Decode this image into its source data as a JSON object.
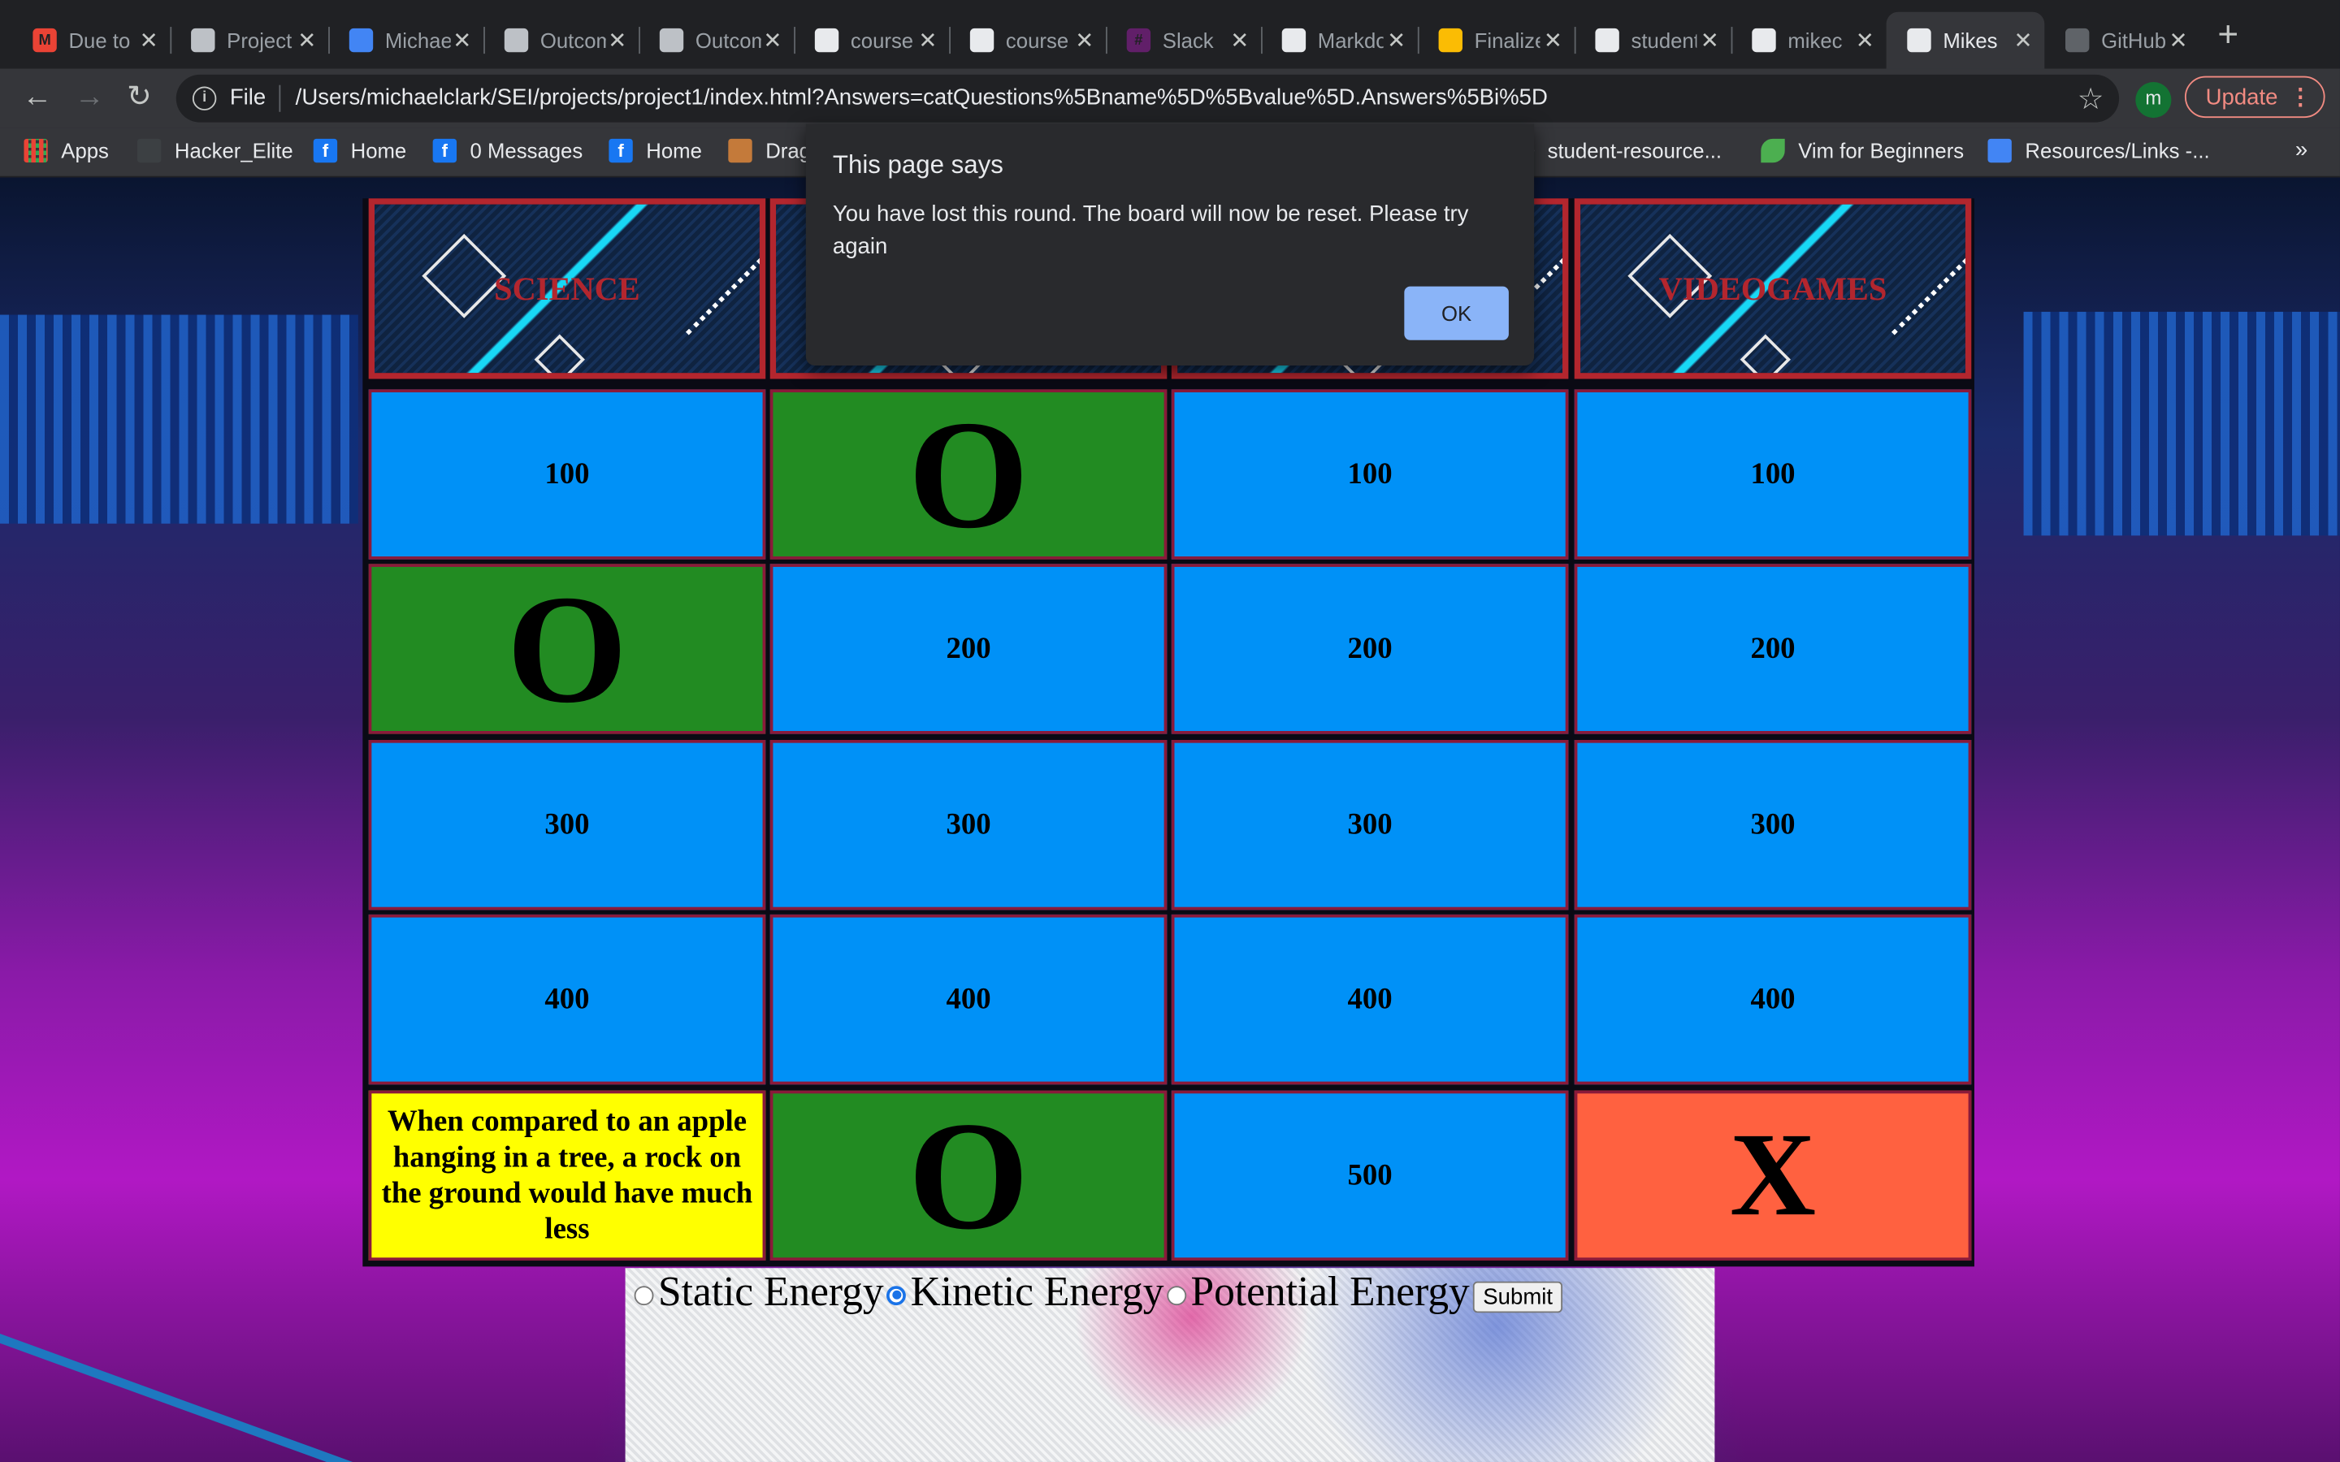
{
  "browser": {
    "tabs": [
      {
        "title": "Due to",
        "icon": "gmail-icon",
        "ico_text": "M",
        "ico_color": "#ea4335"
      },
      {
        "title": "Project",
        "icon": "classroom-icon",
        "ico_text": "",
        "ico_color": "#bdc1c6"
      },
      {
        "title": "Michael",
        "icon": "google-docs-icon",
        "ico_text": "",
        "ico_color": "#4285f4"
      },
      {
        "title": "Outcomes",
        "icon": "classroom-icon",
        "ico_text": "",
        "ico_color": "#bdc1c6"
      },
      {
        "title": "Outcomes",
        "icon": "classroom-icon",
        "ico_text": "",
        "ico_color": "#bdc1c6"
      },
      {
        "title": "course",
        "icon": "github-icon",
        "ico_text": "",
        "ico_color": "#e8eaed"
      },
      {
        "title": "course",
        "icon": "github-icon",
        "ico_text": "",
        "ico_color": "#e8eaed"
      },
      {
        "title": "Slack",
        "icon": "slack-icon",
        "ico_text": "#",
        "ico_color": "#611f69"
      },
      {
        "title": "Markdown",
        "icon": "github-icon",
        "ico_text": "",
        "ico_color": "#e8eaed"
      },
      {
        "title": "Finalize",
        "icon": "slides-icon",
        "ico_text": "",
        "ico_color": "#fbbc04"
      },
      {
        "title": "student",
        "icon": "github-icon",
        "ico_text": "",
        "ico_color": "#e8eaed"
      },
      {
        "title": "mikec",
        "icon": "github-icon",
        "ico_text": "",
        "ico_color": "#e8eaed"
      },
      {
        "title": "Mikes",
        "icon": "globe-icon",
        "ico_text": "",
        "ico_color": "#e8eaed",
        "active": true
      },
      {
        "title": "GitHub",
        "icon": "github-icon",
        "ico_text": "",
        "ico_color": "#5f6368"
      }
    ],
    "new_tab_label": "+",
    "url_scheme": "File",
    "url": "/Users/michaelclark/SEI/projects/project1/index.html?Answers=catQuestions%5Bname%5D%5Bvalue%5D.Answers%5Bi%5D",
    "profile_initial": "m",
    "update_label": "Update",
    "bookmarks": [
      {
        "label": "Apps",
        "icon": "apps-grid-icon"
      },
      {
        "label": "Hacker_Elite",
        "icon": "bookmark-icon"
      },
      {
        "label": "Home",
        "icon": "facebook-icon"
      },
      {
        "label": "0 Messages",
        "icon": "facebook-icon"
      },
      {
        "label": "Home",
        "icon": "facebook-icon"
      },
      {
        "label": "Drag",
        "icon": "image-icon"
      },
      {
        "label": "student-resource...",
        "icon": "github-icon"
      },
      {
        "label": "Vim for Beginners",
        "icon": "vim-leaf-icon"
      },
      {
        "label": "Resources/Links -...",
        "icon": "google-docs-icon"
      }
    ],
    "bookmarks_more": "»"
  },
  "dialog": {
    "title": "This page says",
    "message": "You have lost this round. The board will now be reset. Please try again",
    "ok_label": "OK"
  },
  "board": {
    "categories": [
      "SCIENCE",
      "",
      "",
      "VIDEOGAMES"
    ],
    "rows": [
      [
        {
          "text": "100",
          "state": "blue"
        },
        {
          "text": "O",
          "state": "green"
        },
        {
          "text": "100",
          "state": "blue"
        },
        {
          "text": "100",
          "state": "blue"
        }
      ],
      [
        {
          "text": "O",
          "state": "green"
        },
        {
          "text": "200",
          "state": "blue"
        },
        {
          "text": "200",
          "state": "blue"
        },
        {
          "text": "200",
          "state": "blue"
        }
      ],
      [
        {
          "text": "300",
          "state": "blue"
        },
        {
          "text": "300",
          "state": "blue"
        },
        {
          "text": "300",
          "state": "blue"
        },
        {
          "text": "300",
          "state": "blue"
        }
      ],
      [
        {
          "text": "400",
          "state": "blue"
        },
        {
          "text": "400",
          "state": "blue"
        },
        {
          "text": "400",
          "state": "blue"
        },
        {
          "text": "400",
          "state": "blue"
        }
      ],
      [
        {
          "text": "When compared to an apple hanging in a tree, a rock on the ground would have much less",
          "state": "yellow"
        },
        {
          "text": "O",
          "state": "green"
        },
        {
          "text": "500",
          "state": "blue"
        },
        {
          "text": "X",
          "state": "orange"
        }
      ]
    ]
  },
  "answers": {
    "options": [
      {
        "label": "Static Energy",
        "checked": false
      },
      {
        "label": "Kinetic Energy",
        "checked": true
      },
      {
        "label": "Potential Energy",
        "checked": false
      }
    ],
    "submit_label": "Submit"
  }
}
